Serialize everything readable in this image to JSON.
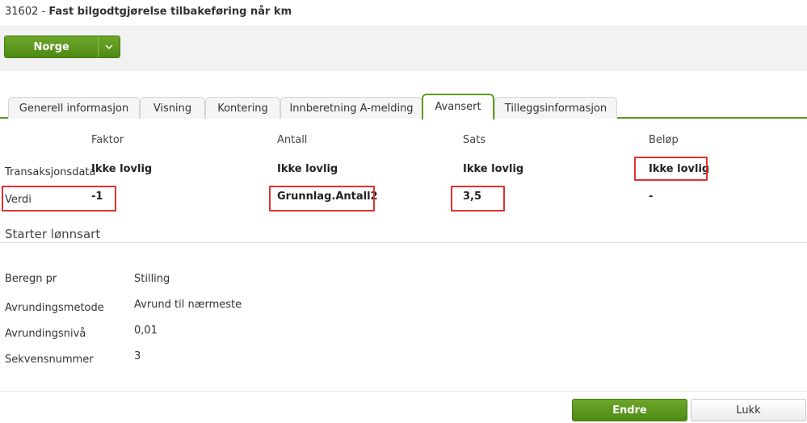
{
  "header": {
    "id": "31602 - ",
    "title": "Fast bilgodtgjørelse tilbakeføring når km"
  },
  "toolbar": {
    "country_button": "Norge",
    "caret_icon": "chevron-down-icon"
  },
  "tabs": [
    {
      "label": "Generell informasjon"
    },
    {
      "label": "Visning"
    },
    {
      "label": "Kontering"
    },
    {
      "label": "Innberetning A-melding"
    },
    {
      "label": "Avansert"
    },
    {
      "label": "Tilleggsinformasjon"
    }
  ],
  "grid": {
    "columns": [
      "Faktor",
      "Antall",
      "Sats",
      "Beløp"
    ],
    "rows": [
      {
        "label": "Transaksjonsdata",
        "values": [
          "Ikke lovlig",
          "Ikke lovlig",
          "Ikke lovlig",
          "Ikke lovlig"
        ]
      },
      {
        "label": "Verdi",
        "values": [
          "-1",
          "Grunnlag.Antall2",
          "3,5",
          "-"
        ]
      }
    ]
  },
  "section": {
    "title": "Starter lønnsart"
  },
  "fields": [
    {
      "label": "Beregn pr",
      "value": "Stilling"
    },
    {
      "label": "Avrundingsmetode",
      "value": "Avrund til nærmeste"
    },
    {
      "label": "Avrundingsnivå",
      "value": "0,01"
    },
    {
      "label": "Sekvensnummer",
      "value": "3"
    }
  ],
  "footer": {
    "edit_button": "Endre",
    "close_button": "Lukk"
  },
  "colors": {
    "accent": "#5b9a1e",
    "highlight": "#e0312f"
  }
}
